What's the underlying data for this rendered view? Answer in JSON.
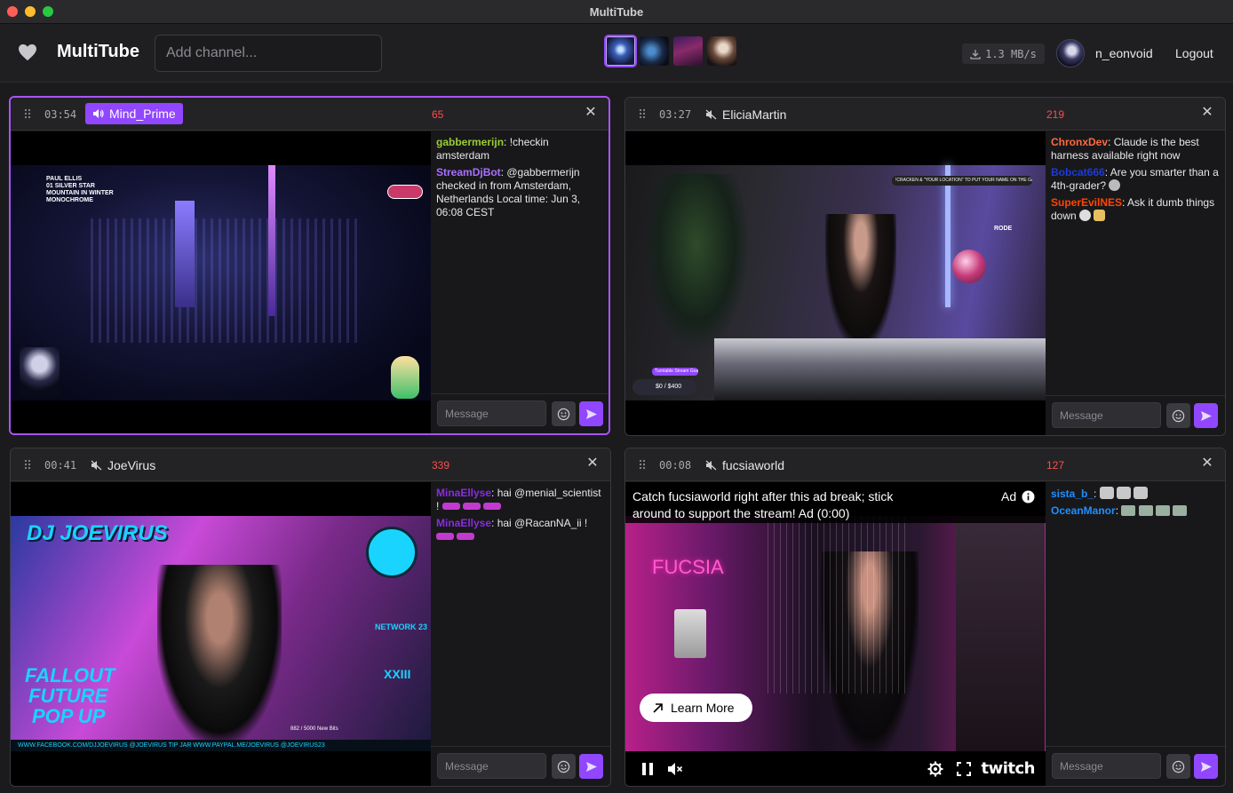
{
  "window": {
    "title": "MultiTube"
  },
  "header": {
    "brand": "MultiTube",
    "add_channel_placeholder": "Add channel...",
    "transfer_rate": "1.3 MB/s",
    "username": "n_eonvoid",
    "logout_label": "Logout"
  },
  "colors": {
    "accent": "#9147ff",
    "active_border": "#a855f7",
    "viewer_count": "#ff4d4d"
  },
  "panels": [
    {
      "elapsed": "03:54",
      "channel": "Mind_Prime",
      "viewers": "65",
      "audio": "on",
      "messages": [
        {
          "nick": "gabbermerijn",
          "color": "#9acd32",
          "text": "!checkin amsterdam"
        },
        {
          "nick": "StreamDjBot",
          "color": "#a970ff",
          "text": "@gabbermerijn checked in from Amsterdam, Netherlands Local time: Jun 3, 06:08 CEST"
        }
      ],
      "video_overlay": {
        "artist": "PAUL ELLIS",
        "track": "01 SILVER STAR",
        "title": "MOUNTAIN IN WINTER",
        "album": "MONOCHROME"
      },
      "chat_placeholder": "Message"
    },
    {
      "elapsed": "03:27",
      "channel": "EliciaMartin",
      "viewers": "219",
      "audio": "muted",
      "messages": [
        {
          "nick": "ChronxDev",
          "color": "#ff6a3d",
          "text": "Claude is the best harness available right now"
        },
        {
          "nick": "Bobcat666",
          "color": "#1d3bd8",
          "text": "Are you smarter than a 4th-grader?"
        },
        {
          "nick": "SuperEvilNES",
          "color": "#ff4500",
          "text": "Ask it dumb things down"
        }
      ],
      "video_overlay": {
        "banner": "!CRACKEN & \"YOUR LOCATION\" TO PUT YOUR NAME ON THE GLOBE",
        "goal_label": "Turntable Stream Goal",
        "goal_value": "$0 / $400",
        "brand": "RODE"
      },
      "chat_placeholder": "Message"
    },
    {
      "elapsed": "00:41",
      "channel": "JoeVirus",
      "viewers": "339",
      "audio": "muted",
      "messages": [
        {
          "nick": "MinaEllyse",
          "color": "#8a2be2",
          "text": "hai @menial_scientist !"
        },
        {
          "nick": "MinaEllyse",
          "color": "#8a2be2",
          "text": "hai @RacanNA_ii !"
        }
      ],
      "video_overlay": {
        "title": "DJ JOEVIRUS",
        "slogan": [
          "FALLOUT",
          "FUTURE",
          "POP UP"
        ],
        "network": "NETWORK 23",
        "roman": "XXIII",
        "bits": "882 / 5000 New Bits",
        "footer": "WWW.FACEBOOK.COM/DJJOEVIRUS  @JOEVIRUS TIP JAR WWW.PAYPAL.ME/JOEVIRUS  @JOEVIRUS23"
      },
      "chat_placeholder": "Message"
    },
    {
      "elapsed": "00:08",
      "channel": "fucsiaworld",
      "viewers": "127",
      "audio": "muted",
      "messages": [
        {
          "nick": "sista_b_",
          "color": "#1e90ff",
          "text": ""
        },
        {
          "nick": "OceanManor",
          "color": "#1e90ff",
          "text": ""
        }
      ],
      "ad": {
        "notice": "Catch fucsiaworld right after this ad break; stick around to support the stream! Ad (0:00)",
        "label": "Ad",
        "learn_more": "Learn More"
      },
      "video_overlay": {
        "brand": "FUCSIA",
        "player_brand": "twitch"
      },
      "chat_placeholder": "Message"
    }
  ]
}
